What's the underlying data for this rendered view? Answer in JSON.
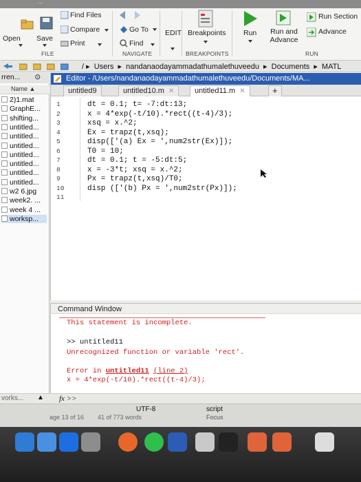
{
  "toolstrip": {
    "open_label": "Open",
    "save_label": "Save",
    "find_files_label": "Find Files",
    "compare_label": "Compare",
    "print_label": "Print",
    "goto_label": "Go To",
    "find_label": "Find",
    "edit_label": "EDIT",
    "breakpoints_label": "Breakpoints",
    "run_label": "Run",
    "run_advance_label": "Run and Advance",
    "run_section_label": "Run Section",
    "advance_label": "Advance",
    "sections": {
      "file": "FILE",
      "navigate": "NAVIGATE",
      "breakpoints": "BREAKPOINTS",
      "run": "RUN"
    }
  },
  "nav": {
    "crumbs": [
      "Users",
      "nandanaodayammadathumalethuveedu",
      "Documents",
      "MATL"
    ]
  },
  "files": {
    "header": "rren...",
    "col_name": "Name",
    "items": [
      "2)1.mat",
      "GraphE...",
      "shifting...",
      "untitled...",
      "untitled...",
      "untitled...",
      "untitled...",
      "untitled...",
      "untitled...",
      "untitled...",
      "w2 6.jpg",
      "week2. ...",
      "week 4 ...",
      "worksp..."
    ],
    "footer": "vorks..."
  },
  "editor": {
    "title": "Editor - /Users/nandanaodayammadathumalethuveedu/Documents/MA...",
    "tabs": [
      "untitled9",
      "untitled10.m",
      "untitled11.m"
    ],
    "add_tab": "+",
    "line_numbers": [
      "1",
      "2",
      "3",
      "4",
      "5",
      "6",
      "7",
      "8",
      "9",
      "10",
      "11"
    ],
    "lines": [
      "dt = 0.1; t= -7:dt:13;",
      "x = 4*exp(-t/10).*rect((t-4)/3);",
      "xsq = x.^2;",
      "Ex = trapz(t,xsq);",
      "disp(['(a) Ex = ',num2str(Ex)]);",
      "T0 = 10;",
      "dt = 0.1; t = -5:dt:5;",
      "x = -3*t; xsq = x.^2;",
      "Px = trapz(t,xsq)/T0;",
      "disp (['(b) Px = ',num2str(Px)]);",
      ""
    ]
  },
  "command_window": {
    "title": "Command Window",
    "incomplete": "This statement is incomplete.",
    "prompt_cmd": ">> untitled11",
    "unrecognized": "Unrecognized function or variable 'rect'.",
    "error_prefix": "Error in ",
    "error_link": "untitled11",
    "error_line": "(line 2)",
    "error_code": "x = 4*exp(-t/10).*rect((t-4)/3);",
    "prompt": "fx >>"
  },
  "statusbar": {
    "encoding": "UTF-8",
    "type": "script",
    "focus": "Focus",
    "page": "age 13 of 16",
    "words": "41 of 773 words"
  },
  "colors": {
    "editor_title": "#2a5db0",
    "error": "#d21e1e"
  }
}
